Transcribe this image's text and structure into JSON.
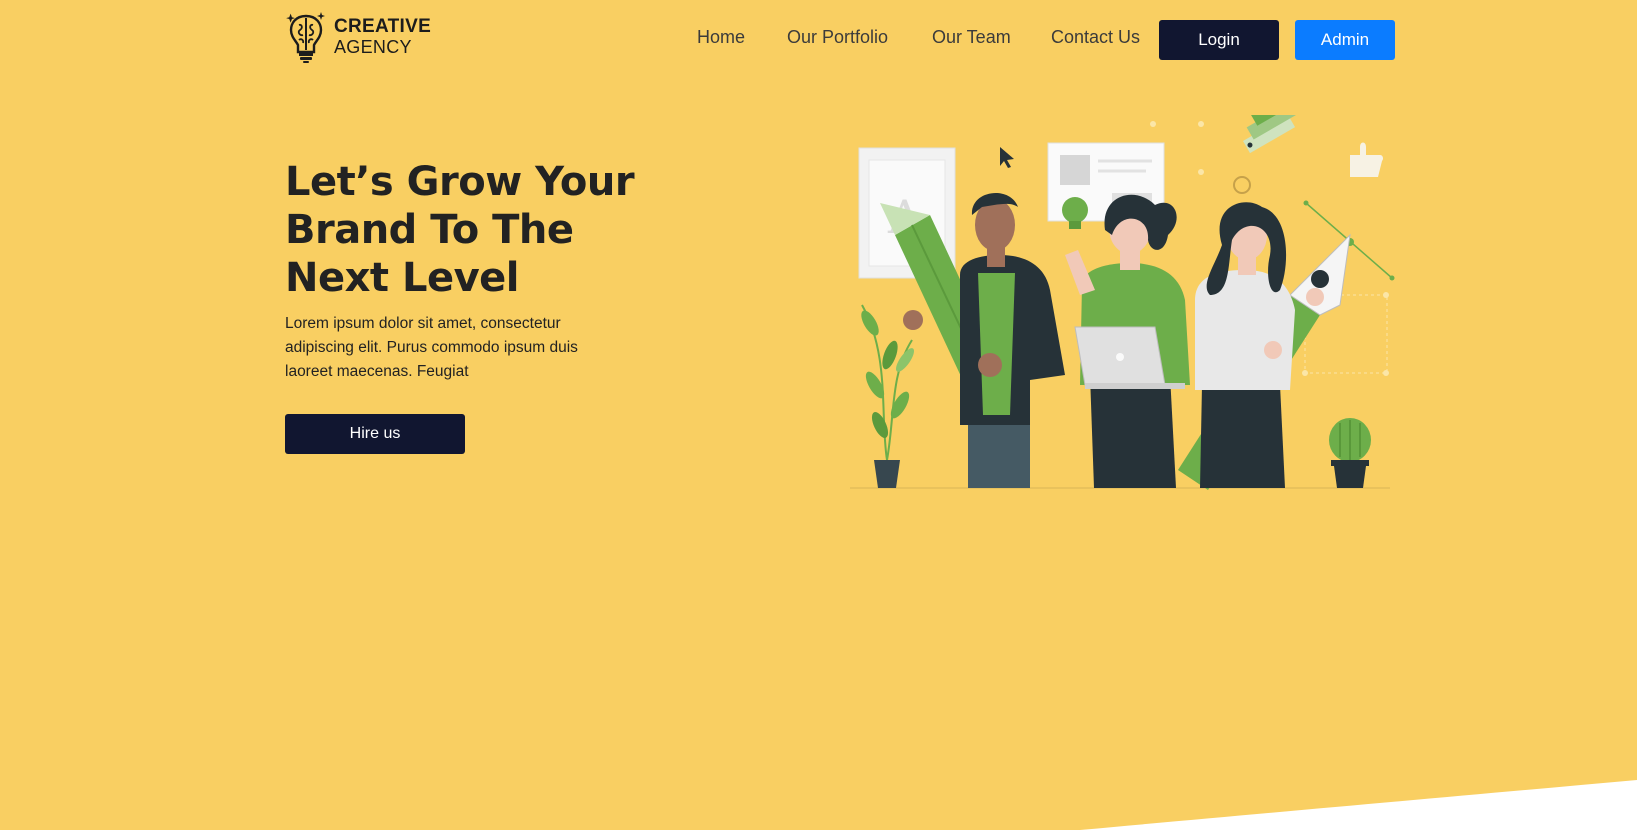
{
  "brand": {
    "line1": "CREATIVE",
    "line2": "AGENCY",
    "logo_icon": "lightbulb-brain-icon"
  },
  "nav": {
    "items": [
      {
        "label": "Home"
      },
      {
        "label": "Our Portfolio"
      },
      {
        "label": "Our Team"
      },
      {
        "label": "Contact Us"
      }
    ],
    "login_label": "Login",
    "admin_label": "Admin"
  },
  "hero": {
    "title": "Let’s Grow Your Brand To The Next Level",
    "text": "Lorem ipsum dolor sit amet, consectetur adipiscing elit. Purus commodo ipsum duis laoreet maecenas. Feugiat",
    "cta_label": "Hire us",
    "illustration_icon": "creative-team-illustration"
  },
  "colors": {
    "background": "#F9CF62",
    "dark_button": "#111630",
    "admin_button": "#0b7cff",
    "illustration_green": "#6DAE4A",
    "illustration_dark": "#263238"
  }
}
